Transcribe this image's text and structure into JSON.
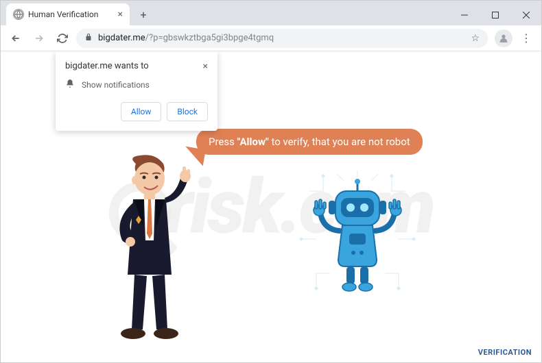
{
  "window": {
    "title": "Human Verification"
  },
  "tab": {
    "title": "Human Verification"
  },
  "address": {
    "domain": "bigdater.me",
    "path": "/?p=gbswkztbga5gi3bpge4tgmq"
  },
  "notification": {
    "title": "bigdater.me wants to",
    "body": "Show notifications",
    "allow": "Allow",
    "block": "Block"
  },
  "speech": {
    "prefix": "Press ",
    "bold": "\"Allow\"",
    "suffix": " to verify, that you are not robot"
  },
  "footer": "VERIFICATION",
  "watermark": "risk.com",
  "icons": {
    "globe": "◯",
    "close_tab": "×",
    "new_tab": "+",
    "back": "←",
    "forward": "→",
    "reload": "⟳",
    "lock": "🔒",
    "star": "☆",
    "menu": "⋮",
    "bell": "🔔",
    "notif_close": "×",
    "profile": "👤"
  }
}
